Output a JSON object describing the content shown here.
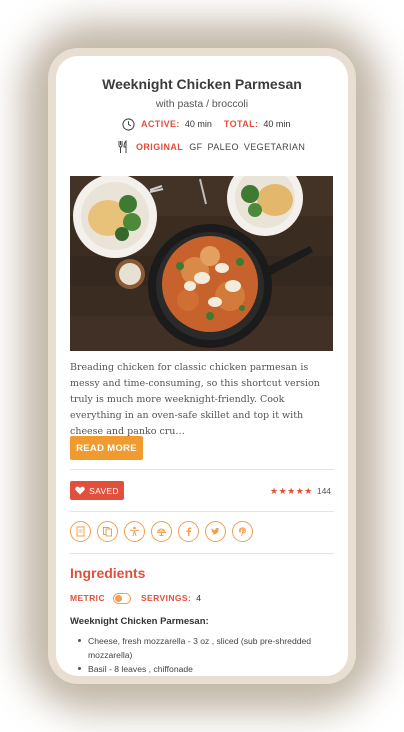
{
  "recipe": {
    "title": "Weeknight Chicken Parmesan",
    "subtitle": "with pasta / broccoli",
    "active_label": "ACTIVE:",
    "active_value": "40 min",
    "total_label": "TOTAL:",
    "total_value": "40 min",
    "original_label": "ORIGINAL",
    "tags": [
      "GF",
      "PALEO",
      "VEGETARIAN"
    ],
    "description": "Breading chicken for classic chicken parmesan is messy and time-consuming, so this shortcut version truly is much more weeknight-friendly. Cook everything in an oven-safe skillet and top it with cheese and panko cru…",
    "read_more": "READ MORE",
    "saved_label": "SAVED",
    "stars": "★★★★★",
    "review_count": "144",
    "rating_fraction": 1.0
  },
  "share_icons": [
    "notebook-icon",
    "copy-icon",
    "cook-mode-icon",
    "dinner-icon",
    "facebook-icon",
    "twitter-icon",
    "pinterest-icon"
  ],
  "ingredients": {
    "title": "Ingredients",
    "metric_label": "METRIC",
    "servings_label": "SERVINGS:",
    "servings_value": "4",
    "section": "Weeknight Chicken Parmesan:",
    "items": [
      "Cheese, fresh mozzarella - 3 oz , sliced (sub pre-shredded mozzarella)",
      "Basil - 8 leaves , chiffonade"
    ]
  },
  "colors": {
    "accent_red": "#e1503c",
    "accent_orange": "#f19a2e",
    "frame": "#e8ded2"
  }
}
